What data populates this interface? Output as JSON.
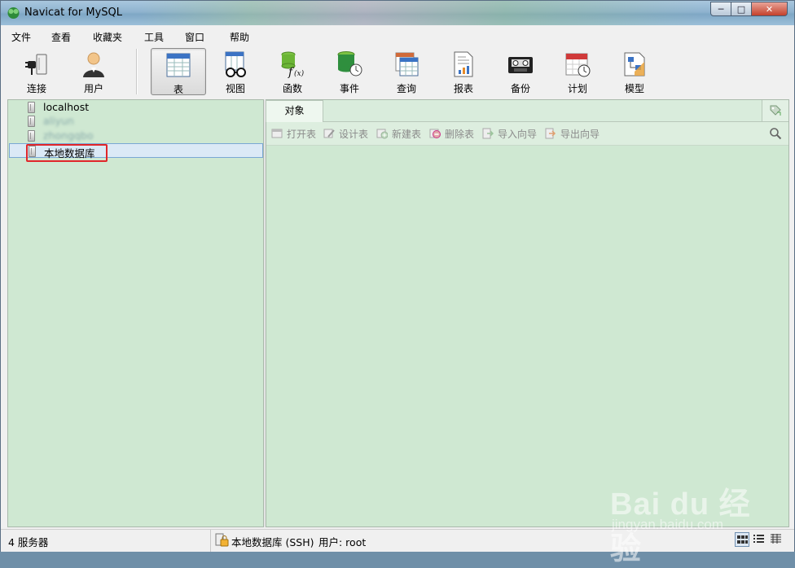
{
  "window": {
    "title": "Navicat for MySQL"
  },
  "menu": [
    "文件",
    "查看",
    "收藏夹",
    "工具",
    "窗口",
    "帮助"
  ],
  "toolbar": {
    "connect": "连接",
    "user": "用户",
    "table": "表",
    "view": "视图",
    "function": "函数",
    "event": "事件",
    "query": "查询",
    "report": "报表",
    "backup": "备份",
    "schedule": "计划",
    "model": "模型"
  },
  "connections": [
    {
      "name": "localhost",
      "blurred": false
    },
    {
      "name": "aliyun",
      "blurred": true
    },
    {
      "name": "zhongqbo",
      "blurred": true
    },
    {
      "name": "本地数据库",
      "blurred": false,
      "selected": true
    }
  ],
  "object_tab": {
    "label": "对象"
  },
  "object_toolbar": {
    "open": "打开表",
    "design": "设计表",
    "new": "新建表",
    "delete": "删除表",
    "import": "导入向导",
    "export": "导出向导"
  },
  "status": {
    "servers": "4 服务器",
    "connection": "本地数据库 (SSH)",
    "user": "用户: root"
  },
  "watermark": {
    "brand": "Bai du 经验",
    "url": "jingyan.baidu.com"
  },
  "colors": {
    "panel_bg": "#cfe8d2",
    "highlight_box": "#e0262a",
    "selected_row": "#dbe9f6"
  }
}
